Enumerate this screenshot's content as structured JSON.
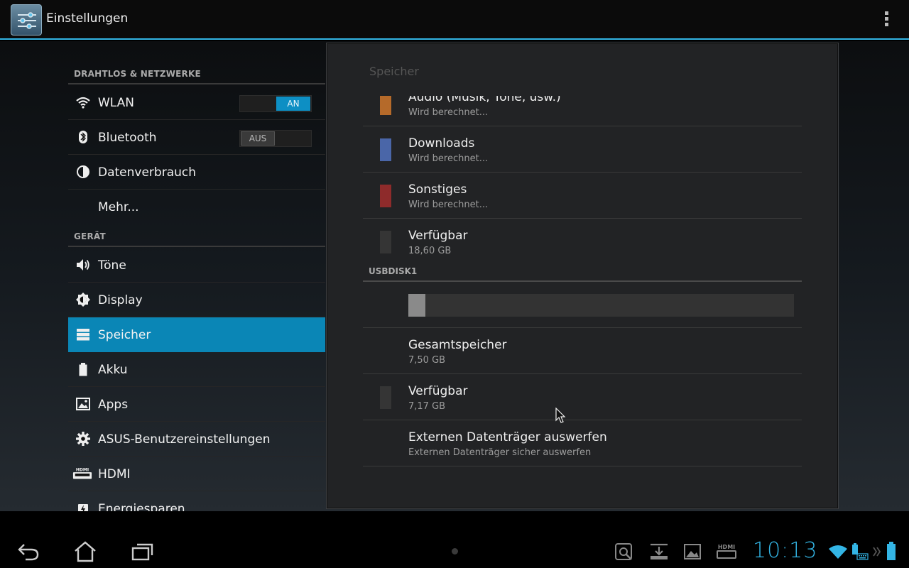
{
  "actionbar": {
    "title": "Einstellungen"
  },
  "left": {
    "categories": [
      {
        "label": "DRAHTLOS & NETZWERKE"
      },
      {
        "label": "GERÄT"
      }
    ],
    "items": [
      {
        "label": "WLAN",
        "icon": "wifi-icon",
        "toggle": "AN"
      },
      {
        "label": "Bluetooth",
        "icon": "bluetooth-icon",
        "toggle": "AUS"
      },
      {
        "label": "Datenverbrauch",
        "icon": "data-usage-icon"
      },
      {
        "label": "Mehr...",
        "icon": ""
      },
      {
        "label": "Töne",
        "icon": "speaker-icon"
      },
      {
        "label": "Display",
        "icon": "brightness-icon"
      },
      {
        "label": "Speicher",
        "icon": "storage-icon",
        "selected": true
      },
      {
        "label": "Akku",
        "icon": "battery-icon"
      },
      {
        "label": "Apps",
        "icon": "apps-icon"
      },
      {
        "label": "ASUS-Benutzereinstellungen",
        "icon": "gear-icon"
      },
      {
        "label": "HDMI",
        "icon": "hdmi-icon"
      },
      {
        "label": "Energiesparen",
        "icon": "power-saving-icon"
      }
    ]
  },
  "panel": {
    "title": "Speicher",
    "rows": [
      {
        "title": "Audio (Musik, Töne, usw.)",
        "sub": "Wird berechnet...",
        "color": "#b56a2a"
      },
      {
        "title": "Downloads",
        "sub": "Wird berechnet...",
        "color": "#4a66a8"
      },
      {
        "title": "Sonstiges",
        "sub": "Wird berechnet...",
        "color": "#8e2b2b"
      },
      {
        "title": "Verfügbar",
        "sub": "18,60 GB",
        "color": "#353535"
      }
    ],
    "usb_category": "USBDISK1",
    "usb_usage_fraction": 0.044,
    "usb_rows": [
      {
        "title": "Gesamtspeicher",
        "sub": "7,50 GB"
      },
      {
        "title": "Verfügbar",
        "sub": "7,17 GB",
        "color": "#353535"
      },
      {
        "title": "Externen Datenträger auswerfen",
        "sub": "Externen Datenträger sicher auswerfen"
      }
    ]
  },
  "sysbar": {
    "clock": "10:13",
    "nav": [
      "back-icon",
      "home-icon",
      "recent-apps-icon"
    ],
    "notifications": [
      "screenshot-icon",
      "download-icon",
      "gallery-icon",
      "hdmi-status-icon"
    ],
    "status": [
      "wifi-status-icon",
      "keyboard-battery-icon",
      "battery-status-icon"
    ]
  },
  "accent": "#33b5e5"
}
